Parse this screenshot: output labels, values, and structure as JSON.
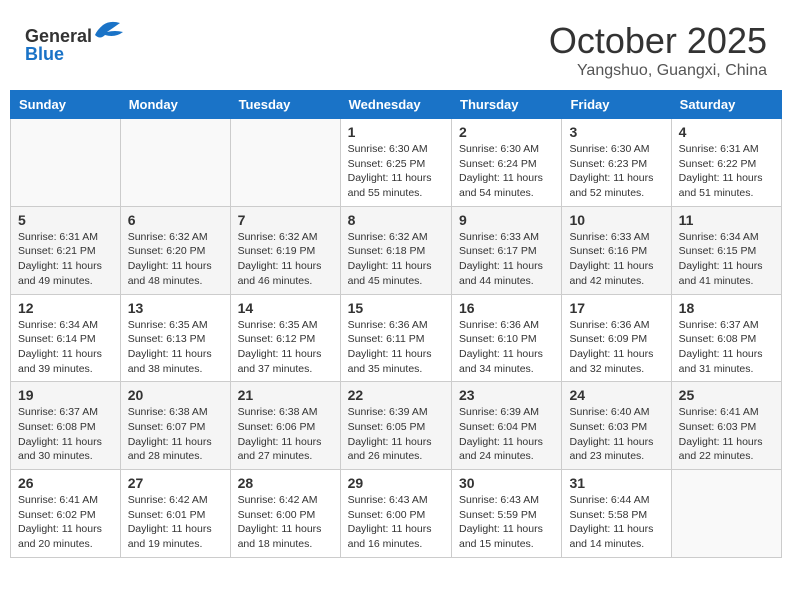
{
  "header": {
    "logo_line1": "General",
    "logo_line2": "Blue",
    "month_year": "October 2025",
    "location": "Yangshuo, Guangxi, China"
  },
  "days_of_week": [
    "Sunday",
    "Monday",
    "Tuesday",
    "Wednesday",
    "Thursday",
    "Friday",
    "Saturday"
  ],
  "weeks": [
    [
      {
        "day": "",
        "info": ""
      },
      {
        "day": "",
        "info": ""
      },
      {
        "day": "",
        "info": ""
      },
      {
        "day": "1",
        "info": "Sunrise: 6:30 AM\nSunset: 6:25 PM\nDaylight: 11 hours\nand 55 minutes."
      },
      {
        "day": "2",
        "info": "Sunrise: 6:30 AM\nSunset: 6:24 PM\nDaylight: 11 hours\nand 54 minutes."
      },
      {
        "day": "3",
        "info": "Sunrise: 6:30 AM\nSunset: 6:23 PM\nDaylight: 11 hours\nand 52 minutes."
      },
      {
        "day": "4",
        "info": "Sunrise: 6:31 AM\nSunset: 6:22 PM\nDaylight: 11 hours\nand 51 minutes."
      }
    ],
    [
      {
        "day": "5",
        "info": "Sunrise: 6:31 AM\nSunset: 6:21 PM\nDaylight: 11 hours\nand 49 minutes."
      },
      {
        "day": "6",
        "info": "Sunrise: 6:32 AM\nSunset: 6:20 PM\nDaylight: 11 hours\nand 48 minutes."
      },
      {
        "day": "7",
        "info": "Sunrise: 6:32 AM\nSunset: 6:19 PM\nDaylight: 11 hours\nand 46 minutes."
      },
      {
        "day": "8",
        "info": "Sunrise: 6:32 AM\nSunset: 6:18 PM\nDaylight: 11 hours\nand 45 minutes."
      },
      {
        "day": "9",
        "info": "Sunrise: 6:33 AM\nSunset: 6:17 PM\nDaylight: 11 hours\nand 44 minutes."
      },
      {
        "day": "10",
        "info": "Sunrise: 6:33 AM\nSunset: 6:16 PM\nDaylight: 11 hours\nand 42 minutes."
      },
      {
        "day": "11",
        "info": "Sunrise: 6:34 AM\nSunset: 6:15 PM\nDaylight: 11 hours\nand 41 minutes."
      }
    ],
    [
      {
        "day": "12",
        "info": "Sunrise: 6:34 AM\nSunset: 6:14 PM\nDaylight: 11 hours\nand 39 minutes."
      },
      {
        "day": "13",
        "info": "Sunrise: 6:35 AM\nSunset: 6:13 PM\nDaylight: 11 hours\nand 38 minutes."
      },
      {
        "day": "14",
        "info": "Sunrise: 6:35 AM\nSunset: 6:12 PM\nDaylight: 11 hours\nand 37 minutes."
      },
      {
        "day": "15",
        "info": "Sunrise: 6:36 AM\nSunset: 6:11 PM\nDaylight: 11 hours\nand 35 minutes."
      },
      {
        "day": "16",
        "info": "Sunrise: 6:36 AM\nSunset: 6:10 PM\nDaylight: 11 hours\nand 34 minutes."
      },
      {
        "day": "17",
        "info": "Sunrise: 6:36 AM\nSunset: 6:09 PM\nDaylight: 11 hours\nand 32 minutes."
      },
      {
        "day": "18",
        "info": "Sunrise: 6:37 AM\nSunset: 6:08 PM\nDaylight: 11 hours\nand 31 minutes."
      }
    ],
    [
      {
        "day": "19",
        "info": "Sunrise: 6:37 AM\nSunset: 6:08 PM\nDaylight: 11 hours\nand 30 minutes."
      },
      {
        "day": "20",
        "info": "Sunrise: 6:38 AM\nSunset: 6:07 PM\nDaylight: 11 hours\nand 28 minutes."
      },
      {
        "day": "21",
        "info": "Sunrise: 6:38 AM\nSunset: 6:06 PM\nDaylight: 11 hours\nand 27 minutes."
      },
      {
        "day": "22",
        "info": "Sunrise: 6:39 AM\nSunset: 6:05 PM\nDaylight: 11 hours\nand 26 minutes."
      },
      {
        "day": "23",
        "info": "Sunrise: 6:39 AM\nSunset: 6:04 PM\nDaylight: 11 hours\nand 24 minutes."
      },
      {
        "day": "24",
        "info": "Sunrise: 6:40 AM\nSunset: 6:03 PM\nDaylight: 11 hours\nand 23 minutes."
      },
      {
        "day": "25",
        "info": "Sunrise: 6:41 AM\nSunset: 6:03 PM\nDaylight: 11 hours\nand 22 minutes."
      }
    ],
    [
      {
        "day": "26",
        "info": "Sunrise: 6:41 AM\nSunset: 6:02 PM\nDaylight: 11 hours\nand 20 minutes."
      },
      {
        "day": "27",
        "info": "Sunrise: 6:42 AM\nSunset: 6:01 PM\nDaylight: 11 hours\nand 19 minutes."
      },
      {
        "day": "28",
        "info": "Sunrise: 6:42 AM\nSunset: 6:00 PM\nDaylight: 11 hours\nand 18 minutes."
      },
      {
        "day": "29",
        "info": "Sunrise: 6:43 AM\nSunset: 6:00 PM\nDaylight: 11 hours\nand 16 minutes."
      },
      {
        "day": "30",
        "info": "Sunrise: 6:43 AM\nSunset: 5:59 PM\nDaylight: 11 hours\nand 15 minutes."
      },
      {
        "day": "31",
        "info": "Sunrise: 6:44 AM\nSunset: 5:58 PM\nDaylight: 11 hours\nand 14 minutes."
      },
      {
        "day": "",
        "info": ""
      }
    ]
  ]
}
